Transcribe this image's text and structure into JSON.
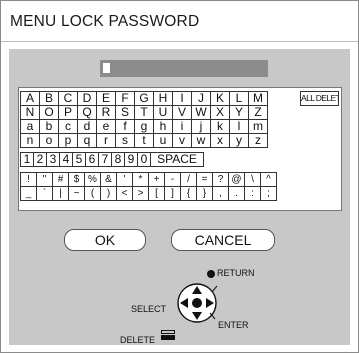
{
  "title": "MENU LOCK PASSWORD",
  "password": {
    "value": ""
  },
  "keyboard": {
    "rows": [
      [
        "A",
        "B",
        "C",
        "D",
        "E",
        "F",
        "G",
        "H",
        "I",
        "J",
        "K",
        "L",
        "M"
      ],
      [
        "N",
        "O",
        "P",
        "Q",
        "R",
        "S",
        "T",
        "U",
        "V",
        "W",
        "X",
        "Y",
        "Z"
      ],
      [
        "a",
        "b",
        "c",
        "d",
        "e",
        "f",
        "g",
        "h",
        "i",
        "j",
        "k",
        "l",
        "m"
      ],
      [
        "n",
        "o",
        "p",
        "q",
        "r",
        "s",
        "t",
        "u",
        "v",
        "w",
        "x",
        "y",
        "z"
      ]
    ],
    "digits": [
      "1",
      "2",
      "3",
      "4",
      "5",
      "6",
      "7",
      "8",
      "9",
      "0"
    ],
    "space_label": "SPACE",
    "symbols_row1": [
      "!",
      "\"",
      "#",
      "$",
      "%",
      "&",
      "'",
      "*",
      "+",
      "-",
      "/",
      "=",
      "?",
      "@",
      "\\",
      "^"
    ],
    "symbols_row2": [
      "_",
      "`",
      "|",
      "~",
      "(",
      ")",
      "<",
      ">",
      "[",
      "]",
      "{",
      "}",
      ",",
      ".",
      ":",
      ";"
    ],
    "all_delete_label": "ALL DELETE"
  },
  "buttons": {
    "ok": "OK",
    "cancel": "CANCEL"
  },
  "legend": {
    "select": "SELECT",
    "return": "RETURN",
    "enter": "ENTER",
    "delete": "DELETE"
  }
}
